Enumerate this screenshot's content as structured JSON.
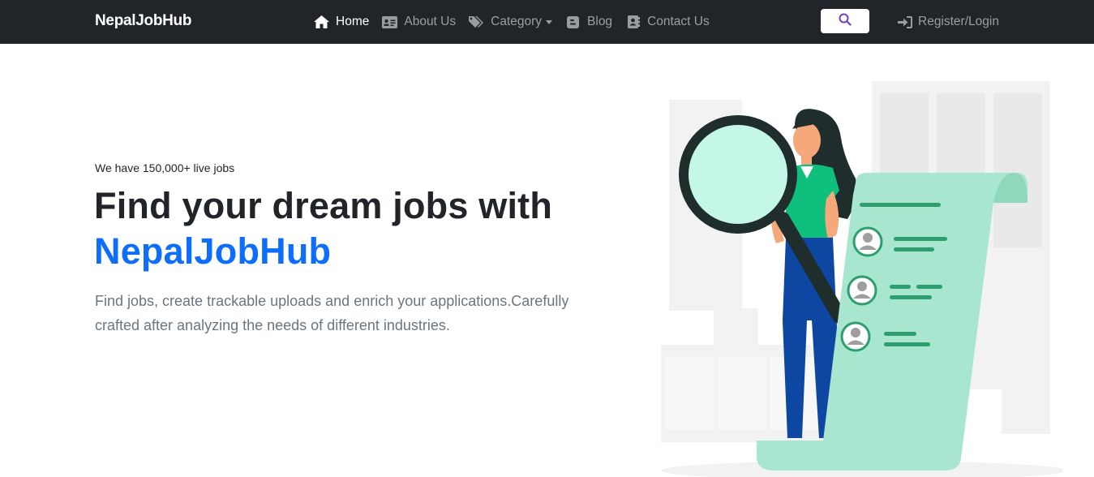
{
  "navbar": {
    "brand": "NepalJobHub",
    "items": [
      {
        "label": "Home",
        "icon": "home-icon",
        "active": true
      },
      {
        "label": "About Us",
        "icon": "id-card-icon",
        "active": false
      },
      {
        "label": "Category",
        "icon": "tags-icon",
        "active": false,
        "dropdown": true
      },
      {
        "label": "Blog",
        "icon": "blog-icon",
        "active": false
      },
      {
        "label": "Contact Us",
        "icon": "address-book-icon",
        "active": false
      }
    ],
    "search_icon": "search-icon",
    "login_label": "Register/Login",
    "login_icon": "sign-in-icon"
  },
  "hero": {
    "tagline": "We have 150,000+ live jobs",
    "headline": "Find your dream jobs with",
    "headline_brand": "NepalJobHub",
    "description": "Find jobs, create trackable uploads and enrich your applications.Carefully crafted after analyzing the needs of different industries."
  },
  "colors": {
    "navbar_bg": "#212529",
    "brand_accent": "#0d6efd",
    "search_icon": "#6f42c1",
    "illustration_mint": "#a8e6cf",
    "illustration_green": "#2e9e6e"
  }
}
